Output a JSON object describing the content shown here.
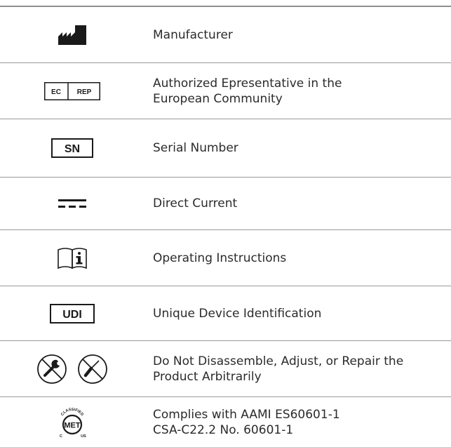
{
  "symbols": [
    {
      "icon": "manufacturer-icon",
      "lines": [
        "Manufacturer"
      ]
    },
    {
      "icon": "ec-rep-icon",
      "icon_text": [
        "EC",
        "REP"
      ],
      "lines": [
        "Authorized Epresentative in the",
        "European Community"
      ]
    },
    {
      "icon": "serial-number-icon",
      "icon_text": "SN",
      "lines": [
        "Serial Number"
      ]
    },
    {
      "icon": "direct-current-icon",
      "lines": [
        "Direct Current"
      ]
    },
    {
      "icon": "operating-instructions-icon",
      "lines": [
        "Operating Instructions"
      ]
    },
    {
      "icon": "udi-icon",
      "icon_text": "UDI",
      "lines": [
        "Unique Device Identification"
      ]
    },
    {
      "icon": "do-not-disassemble-icon",
      "lines": [
        "Do Not Disassemble, Adjust, or Repair the",
        "Product Arbitrarily"
      ]
    },
    {
      "icon": "met-classified-icon",
      "icon_text": [
        "CLASSIFIED",
        "MET",
        "C",
        "US"
      ],
      "lines": [
        "Complies with AAMI ES60601-1",
        "CSA-C22.2 No. 60601-1"
      ]
    }
  ]
}
